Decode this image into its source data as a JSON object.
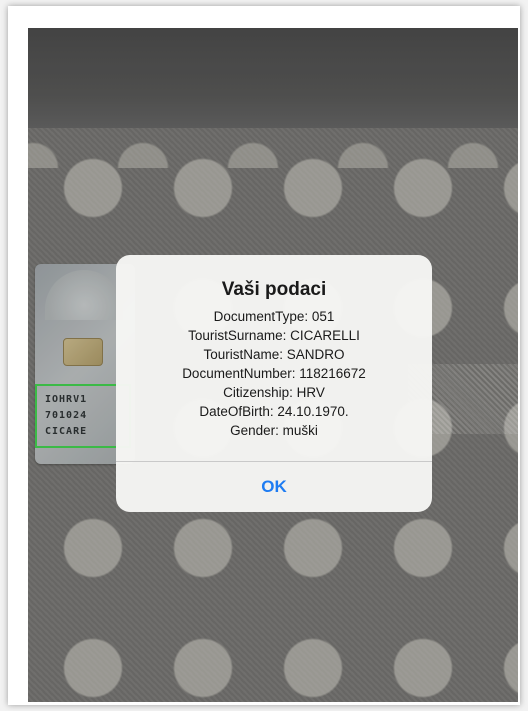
{
  "colors": {
    "accent": "#1e7cf2",
    "mrz_frame": "#3ecb4a"
  },
  "id_card": {
    "mrz_lines": [
      "IOHRV1",
      "701024",
      "CICARE"
    ]
  },
  "alert": {
    "title": "Vaši podaci",
    "lines": [
      "DocumentType: 051",
      "TouristSurname: CICARELLI",
      "TouristName: SANDRO",
      "DocumentNumber: 118216672",
      "Citizenship: HRV",
      "DateOfBirth: 24.10.1970.",
      "Gender: muški"
    ],
    "ok_label": "OK"
  }
}
